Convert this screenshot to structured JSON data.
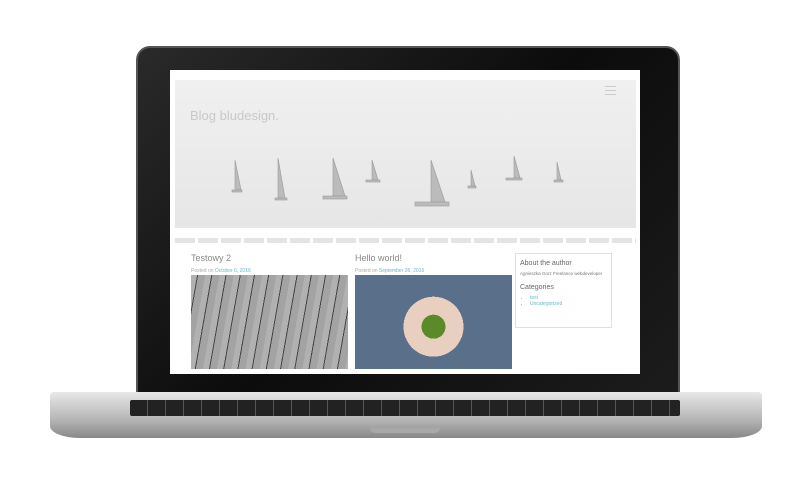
{
  "site": {
    "title": "Blog bludesign."
  },
  "posts": [
    {
      "title": "Testowy 2",
      "posted_on": "Posted on",
      "date": "October 6, 2016"
    },
    {
      "title": "Hello world!",
      "posted_on": "Posted on",
      "date": "September 26, 2016"
    }
  ],
  "sidebar": {
    "about_heading": "About the author",
    "about_text": "Agnieszka Gorz Freelance webdeveloper",
    "categories_heading": "Categories",
    "categories": [
      "test",
      "Uncategorized"
    ]
  },
  "colors": {
    "link": "#6ab7c9",
    "border": "#cfe6ea"
  }
}
